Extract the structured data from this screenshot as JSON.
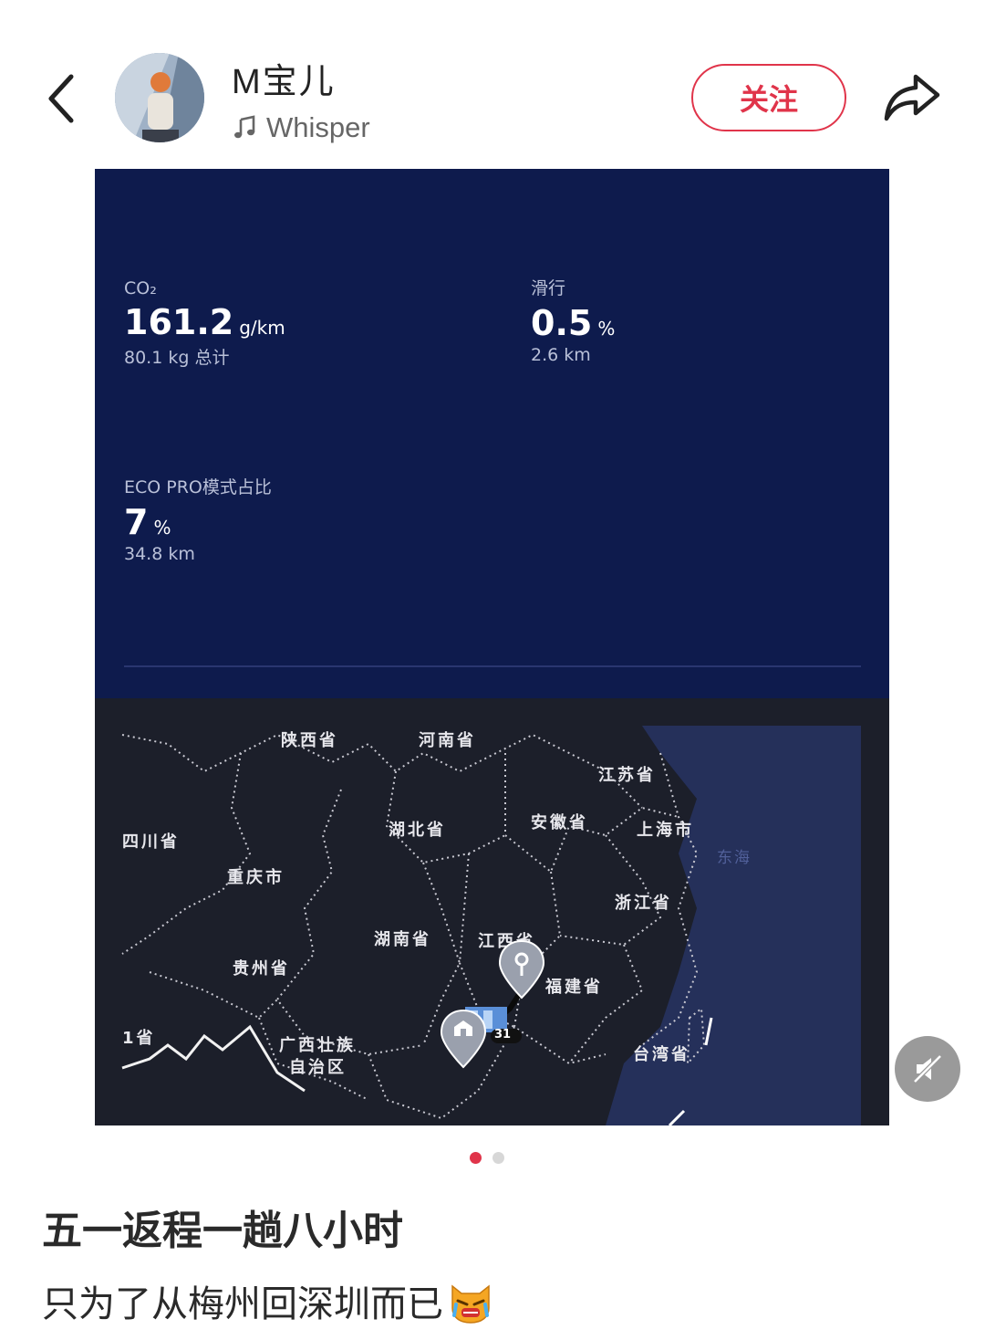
{
  "header": {
    "back_icon": "chevron-left-icon",
    "username": "M宝儿",
    "music_icon": "music-note-icon",
    "music_title": "Whisper",
    "follow_label": "关注",
    "share_icon": "share-arrow-icon",
    "accent_color": "#e0344a"
  },
  "stats": {
    "co2": {
      "label": "CO₂",
      "value": "161.2",
      "unit": "g/km",
      "sub": "80.1 kg 总计"
    },
    "coast": {
      "label": "滑行",
      "value": "0.5",
      "unit": "%",
      "sub": "2.6 km"
    },
    "eco": {
      "label": "ECO PRO模式占比",
      "value": "7",
      "unit": "%",
      "sub": "34.8 km"
    },
    "panel_color": "#0e1b4d"
  },
  "map": {
    "regions": [
      "陕西省",
      "河南省",
      "江苏省",
      "四川省",
      "湖北省",
      "安徽省",
      "上海市",
      "重庆市",
      "浙江省",
      "湖南省",
      "江西省",
      "贵州省",
      "福建省",
      "广西壮族",
      "自治区",
      "台湾省",
      "1省"
    ],
    "sea": "东海",
    "destination_pin_icon": "location-pin-icon",
    "home_pin_icon": "home-pin-icon",
    "flag_icon": "route-flag-icon",
    "flag_badge": "31"
  },
  "mute_icon": "mute-speaker-icon",
  "pagination": {
    "total": 2,
    "active": 1
  },
  "post": {
    "title": "五一返程一趟八小时",
    "body": "只为了从梅州回深圳而已",
    "emoji": "crying-cat-emoji"
  }
}
